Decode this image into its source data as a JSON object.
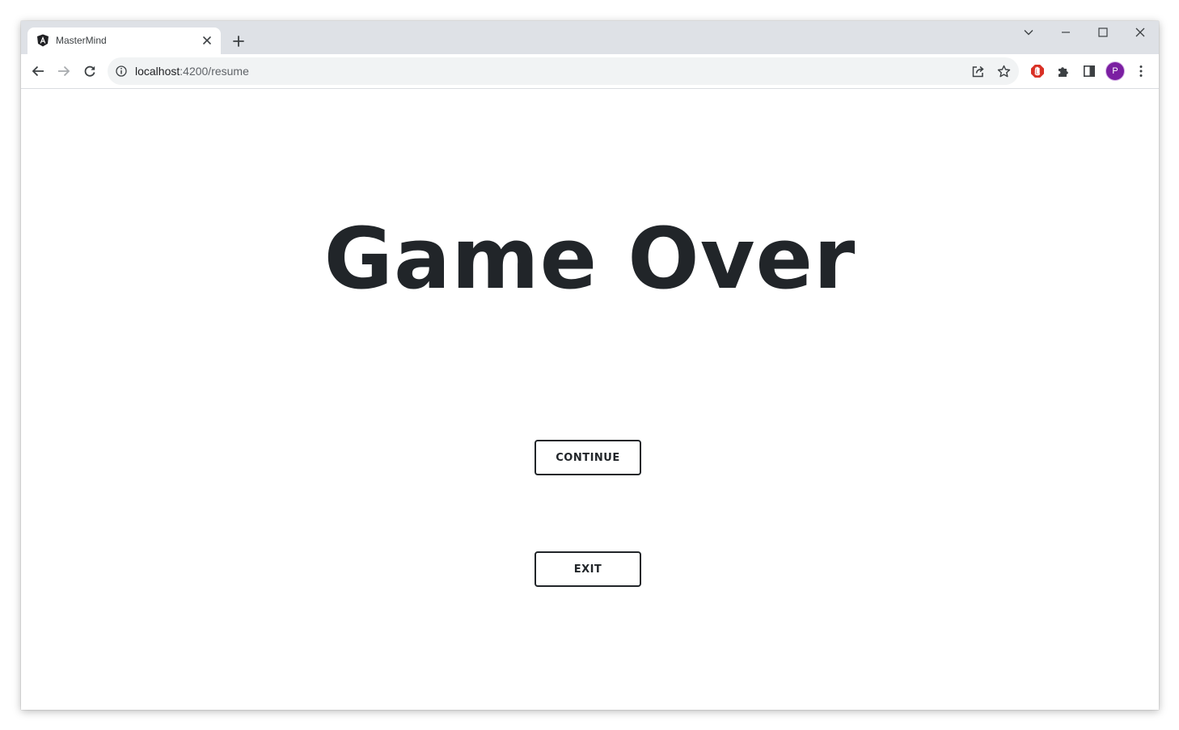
{
  "browser": {
    "tab": {
      "title": "MasterMind",
      "favicon": "angular-icon"
    },
    "address_bar": {
      "host": "localhost",
      "port_path": ":4200/resume"
    },
    "profile_initial": "P",
    "profile_color": "#7b1fa2"
  },
  "page": {
    "heading": "Game Over",
    "buttons": {
      "continue_label": "CONTINUE",
      "exit_label": "EXIT"
    }
  },
  "colors": {
    "text_dark": "#212529",
    "tab_strip": "#dee1e6",
    "omnibox": "#f1f3f4",
    "ad_block_red": "#d93025"
  }
}
